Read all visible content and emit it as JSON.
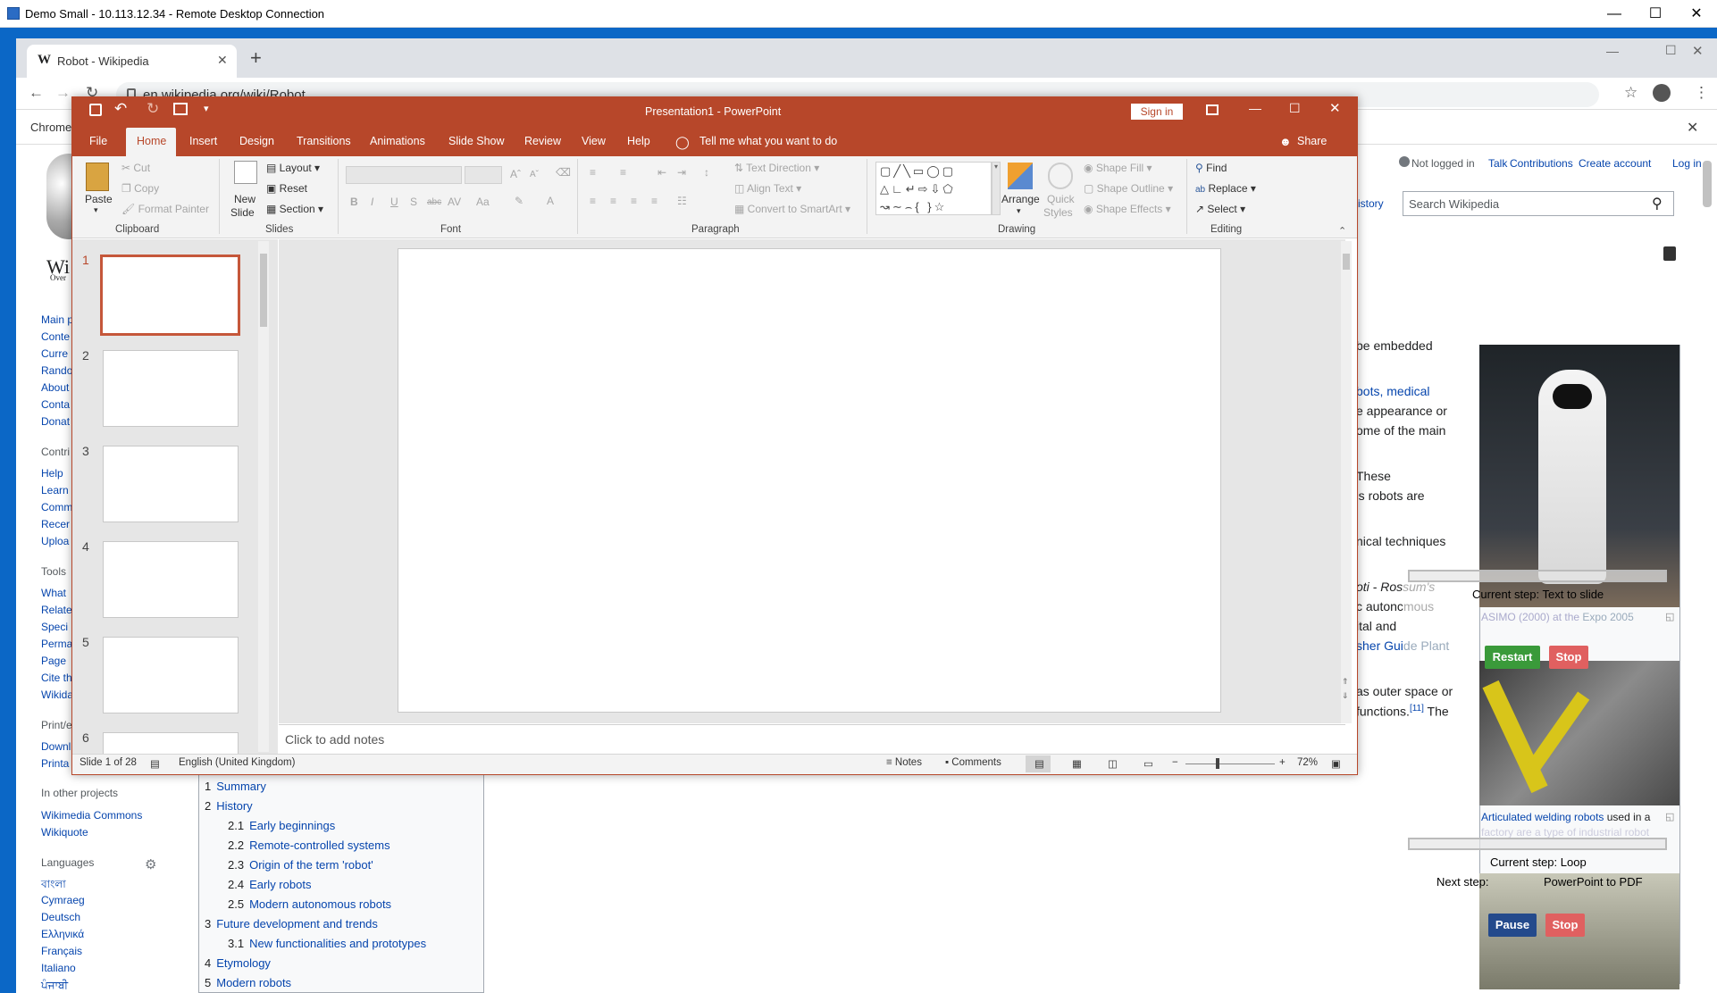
{
  "rdp": {
    "title": "Demo Small - 10.113.12.34 - Remote Desktop Connection"
  },
  "browser": {
    "tab_title": "Robot - Wikipedia",
    "tab_favicon": "W",
    "url": "en.wikipedia.org/wiki/Robot",
    "infobar_text": "Chrome"
  },
  "wiki": {
    "top_links": [
      "Not logged in",
      "Talk",
      "Contributions",
      "Create account",
      "Log in"
    ],
    "history_tab": "istory",
    "search_placeholder": "Search Wikipedia",
    "logo_text": "Wi",
    "logo_sub": "Over",
    "nav": [
      "Main p",
      "Conte",
      "Curre",
      "Rando",
      "About",
      "Conta",
      "Donat"
    ],
    "contribute_heading": "Contri",
    "contribute": [
      "Help",
      "Learn",
      "Comm",
      "Recer",
      "Uploa"
    ],
    "tools_heading": "Tools",
    "tools": [
      "What",
      "Relate",
      "Speci",
      "Perma",
      "Page",
      "Cite th",
      "Wikida"
    ],
    "print_heading": "Print/e",
    "print": [
      "Downl",
      "Printa"
    ],
    "other_heading": "In other projects",
    "other": [
      "Wikimedia Commons",
      "Wikiquote"
    ],
    "lang_heading": "Languages",
    "languages": [
      "বাংলা",
      "Cymraeg",
      "Deutsch",
      "Ελληνικά",
      "Français",
      "Italiano",
      "ਪੰਜਾਬੀ"
    ],
    "toc": [
      {
        "n": "1",
        "t": "Summary",
        "lvl": 0
      },
      {
        "n": "2",
        "t": "History",
        "lvl": 0
      },
      {
        "n": "2.1",
        "t": "Early beginnings",
        "lvl": 1
      },
      {
        "n": "2.2",
        "t": "Remote-controlled systems",
        "lvl": 1
      },
      {
        "n": "2.3",
        "t": "Origin of the term 'robot'",
        "lvl": 1
      },
      {
        "n": "2.4",
        "t": "Early robots",
        "lvl": 1
      },
      {
        "n": "2.5",
        "t": "Modern autonomous robots",
        "lvl": 1
      },
      {
        "n": "3",
        "t": "Future development and trends",
        "lvl": 0
      },
      {
        "n": "3.1",
        "t": "New functionalities and prototypes",
        "lvl": 1
      },
      {
        "n": "4",
        "t": "Etymology",
        "lvl": 0
      },
      {
        "n": "5",
        "t": "Modern robots",
        "lvl": 0
      }
    ],
    "article": {
      "l1": "be embedded",
      "l2": "bots, medical",
      "l3": "e appearance or",
      "l4": "ome of the main",
      "l5": "These",
      "l6": "'s robots are",
      "l7": "nical techniques",
      "l8a": "oti - Ros",
      "l8b": "sum's",
      "l9a": "c autonc",
      "l9b": "mous",
      "l10": "ital and",
      "l11a": "sher Gui",
      "l11b": "de Plant",
      "l12": "as outer space or",
      "l13a": "functions.",
      "l13b": "[11]",
      "l13c": " The"
    },
    "caption1a": "ASIMO (2000) at the ",
    "caption1b": "Expo 2005",
    "caption2a": "Articulated welding robots",
    "caption2b": " used in a",
    "caption2c": "factory are a type of industrial robot"
  },
  "overlay": {
    "current_step_1": "Current step: Text to slide",
    "restart": "Restart",
    "stop": "Stop",
    "current_step_2": "Current step: Loop",
    "next_step_label": "Next step:",
    "next_step_value": "PowerPoint to PDF",
    "pause": "Pause",
    "stop2": "Stop"
  },
  "ppt": {
    "title": "Presentation1  -  PowerPoint",
    "sign_in": "Sign in",
    "tabs": [
      "File",
      "Home",
      "Insert",
      "Design",
      "Transitions",
      "Animations",
      "Slide Show",
      "Review",
      "View",
      "Help"
    ],
    "tell_me": "Tell me what you want to do",
    "share": "Share",
    "clipboard": {
      "paste": "Paste",
      "cut": "Cut",
      "copy": "Copy",
      "format_painter": "Format Painter",
      "label": "Clipboard"
    },
    "slides": {
      "new_slide": "New",
      "new_slide2": "Slide",
      "layout": "Layout",
      "reset": "Reset",
      "section": "Section",
      "label": "Slides"
    },
    "font": {
      "label": "Font",
      "bold": "B",
      "italic": "I",
      "underline": "U",
      "shadow": "S",
      "strike": "abc",
      "spacing": "AV",
      "case": "Aa",
      "color": "A"
    },
    "paragraph": {
      "label": "Paragraph",
      "text_direction": "Text Direction",
      "align_text": "Align Text",
      "smartart": "Convert to SmartArt"
    },
    "drawing": {
      "label": "Drawing",
      "arrange": "Arrange",
      "quick": "Quick",
      "styles": "Styles",
      "fill": "Shape Fill",
      "outline": "Shape Outline",
      "effects": "Shape Effects"
    },
    "editing": {
      "label": "Editing",
      "find": "Find",
      "replace": "Replace",
      "select": "Select"
    },
    "thumbs": [
      "1",
      "2",
      "3",
      "4",
      "5",
      "6"
    ],
    "notes_placeholder": "Click to add notes",
    "status": {
      "slide": "Slide 1 of 28",
      "language": "English (United Kingdom)",
      "notes": "Notes",
      "comments": "Comments",
      "zoom": "72%"
    }
  },
  "colors": {
    "ppt_accent": "#b7472a",
    "wiki_link": "#0645ad",
    "desktop_blue": "#0b67c6"
  }
}
